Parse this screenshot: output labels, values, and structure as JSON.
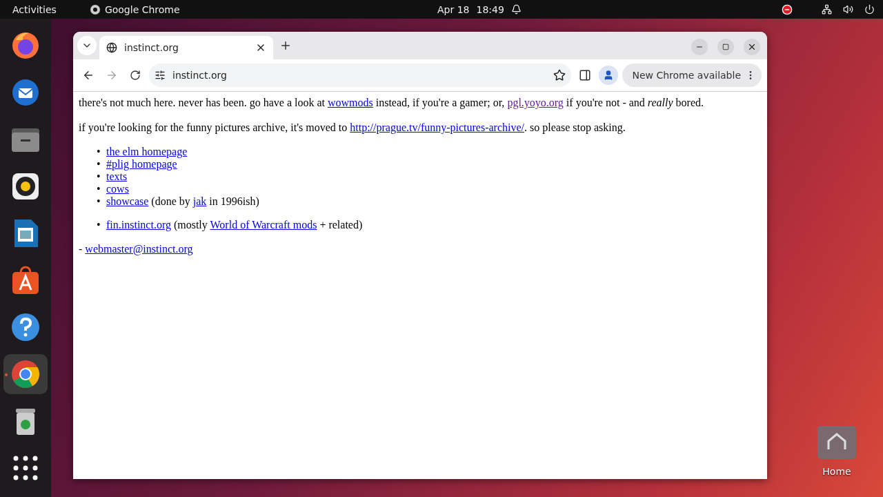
{
  "top_bar": {
    "activities": "Activities",
    "app": "Google Chrome",
    "date": "Apr 18",
    "time": "18:49"
  },
  "dock": [
    {
      "kind": "firefox",
      "selected": false
    },
    {
      "kind": "mail",
      "selected": false
    },
    {
      "kind": "files",
      "selected": false
    },
    {
      "kind": "speaker",
      "selected": false
    },
    {
      "kind": "document",
      "selected": false
    },
    {
      "kind": "store",
      "selected": false
    },
    {
      "kind": "help",
      "selected": false
    },
    {
      "kind": "chrome",
      "selected": true
    },
    {
      "kind": "trash",
      "selected": false
    },
    {
      "kind": "apps",
      "selected": false
    }
  ],
  "browser": {
    "tabs": [
      {
        "title": "instinct.org",
        "selected": true
      }
    ],
    "address": "instinct.org",
    "update_button": "New Chrome available"
  },
  "page": {
    "blocks": [
      {
        "kind": "paragraph",
        "parts": [
          {
            "text": "there's not much here. never has been. go have a look at "
          },
          {
            "link": "wowmods",
            "visited": false
          },
          {
            "text": " instead, if you're a gamer; or, "
          },
          {
            "link": "pgl.yoyo.org",
            "visited": true
          },
          {
            "text": " if you're not - and *really* bored."
          }
        ]
      },
      {
        "kind": "paragraph",
        "parts": [
          {
            "text": "if you're looking for the funny pictures archive, it's moved to "
          },
          {
            "link": "http://prague.tv/funny-pictures-archive/",
            "visited": false
          },
          {
            "text": ". so please stop asking."
          }
        ]
      },
      {
        "kind": "list",
        "items": [
          {
            "bullet": "•",
            "parts": [
              {
                "link": "the elm homepage",
                "visited": false
              }
            ]
          },
          {
            "bullet": "•",
            "parts": [
              {
                "link": "#plig homepage",
                "visited": false
              }
            ]
          },
          {
            "bullet": "•",
            "parts": [
              {
                "link": "texts",
                "visited": false
              }
            ]
          },
          {
            "bullet": "•",
            "parts": [
              {
                "link": "cows",
                "visited": false
              }
            ]
          },
          {
            "bullet": "•",
            "parts": [
              {
                "link": "showcase",
                "visited": false
              },
              {
                "text": " (done by "
              },
              {
                "link": "jak",
                "visited": false
              },
              {
                "text": " in 1996ish)"
              }
            ]
          }
        ]
      },
      {
        "kind": "list",
        "items": [
          {
            "bullet": "•",
            "parts": [
              {
                "link": "fin.instinct.org",
                "visited": false
              },
              {
                "text": " (mostly "
              },
              {
                "link": "World of Warcraft mods",
                "visited": false
              },
              {
                "text": " + related)"
              }
            ]
          }
        ]
      },
      {
        "kind": "paragraph",
        "parts": [
          {
            "text": "- "
          },
          {
            "link": "webmaster@instinct.org",
            "visited": false
          }
        ]
      }
    ]
  },
  "desktop_icons": [
    {
      "label": "Home"
    }
  ]
}
